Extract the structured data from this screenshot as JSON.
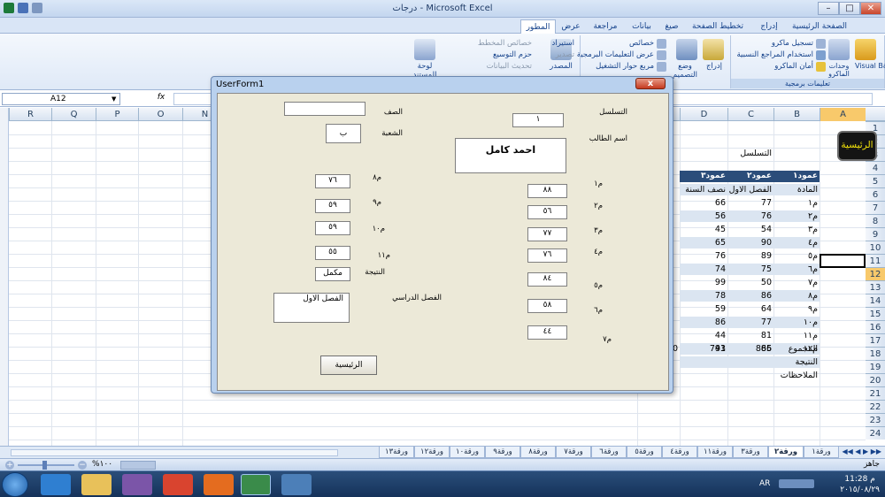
{
  "window": {
    "title": "درجات - Microsoft Excel"
  },
  "ribbon_tabs": [
    "الصفحة الرئيسية",
    "إدراج",
    "تخطيط الصفحة",
    "صيغ",
    "بيانات",
    "مراجعة",
    "عرض",
    "المطور"
  ],
  "active_tab": "المطور",
  "ribbon": {
    "code_group_label": "تعليمات برمجية",
    "visual_basic": "Visual Basic",
    "macros": "وحدات الماكرو",
    "record_macro": "تسجيل ماكرو",
    "relative_refs": "استخدام المراجع النسبية",
    "macro_security": "أمان الماكرو",
    "insert": "إدراج",
    "design_mode": "وضع التصميم",
    "properties": "خصائص",
    "view_code": "عرض التعليمات البرمجية",
    "run_dialog": "مربع حوار التشغيل",
    "source": "المصدر",
    "map_props": "خصائص المخطط",
    "expansion_packs": "حزم التوسيع",
    "refresh_data": "تحديث البيانات",
    "import": "استيراد",
    "export": "تصدير",
    "doc_panel": "لوحة المستند"
  },
  "formula_bar": {
    "name_box": "A12",
    "fx": "fx"
  },
  "columns": [
    "R",
    "Q",
    "P",
    "O",
    "N",
    "E",
    "D",
    "C",
    "B",
    "A"
  ],
  "rows": [
    "1",
    "2",
    "3",
    "4",
    "5",
    "6",
    "7",
    "8",
    "9",
    "10",
    "11",
    "12",
    "13",
    "14",
    "15",
    "16",
    "17",
    "18",
    "19",
    "20",
    "21",
    "22",
    "23",
    "24"
  ],
  "selected": {
    "column": "A",
    "row": "12"
  },
  "sheet": {
    "header_sequence": "التسلسل",
    "table_headers": [
      "عمود١",
      "عمود٢",
      "عمود٣"
    ],
    "subheaders": [
      "المادة",
      "الفصل الاول",
      "نصف السنة"
    ],
    "subjects": [
      "م١",
      "م٢",
      "م٣",
      "م٤",
      "م٥",
      "م٦",
      "م٧",
      "م٨",
      "م٩",
      "م١٠",
      "م١١",
      "م١٢"
    ],
    "col_c": [
      "77",
      "76",
      "54",
      "90",
      "89",
      "75",
      "50",
      "86",
      "64",
      "77",
      "81",
      "66"
    ],
    "col_d": [
      "66",
      "56",
      "45",
      "65",
      "76",
      "74",
      "99",
      "78",
      "59",
      "86",
      "44",
      "43"
    ],
    "total_label": "المجموع",
    "total_c": "885",
    "total_d": "791",
    "total_e": "0",
    "result_label": "النتيجة",
    "notes_label": "الملاحظات",
    "main_button": "الرئيسية"
  },
  "sheet_tabs": [
    "ورقة١",
    "ورقة٢",
    "ورقة٣",
    "ورقة١١",
    "ورقة٤",
    "ورقة٥",
    "ورقة٦",
    "ورقة٧",
    "ورقة٨",
    "ورقة٩",
    "ورقة١٠",
    "ورقة١٢",
    "ورقة١٣"
  ],
  "active_sheet": "ورقة٢",
  "status": {
    "ready": "جاهز",
    "zoom": "١٠٠%"
  },
  "taskbar": {
    "language": "AR",
    "time": "11:28 م",
    "date": "٢٠١٥/٠٨/٢٩"
  },
  "userform": {
    "title": "UserForm1",
    "close": "x",
    "labels": {
      "seq": "التسلسل",
      "student": "اسم الطالب",
      "class": "الصف",
      "section": "الشعبة",
      "m1": "م١",
      "m2": "م٢",
      "m3": "م٣",
      "m4": "م٤",
      "m5": "م٥",
      "m6": "م٦",
      "m7": "م٧",
      "m8": "م٨",
      "m9": "م٩",
      "m10": "م١٠",
      "m11": "م١١",
      "result": "النتيجة",
      "semester": "الفصل الدراسي"
    },
    "values": {
      "seq": "١",
      "student": "احمد كامل",
      "class": "",
      "section": "ب",
      "m1": "٨٨",
      "m2": "٥٦",
      "m3": "٧٧",
      "m4": "٧٦",
      "m5": "٨٤",
      "m6": "٥٨",
      "m7": "٤٤",
      "m8": "٧٦",
      "m9": "٥٩",
      "m10": "٥٩",
      "m11": "٥٥",
      "result": "مكمل",
      "semester": "الفصل الاول"
    },
    "button": "الرئيسية"
  }
}
